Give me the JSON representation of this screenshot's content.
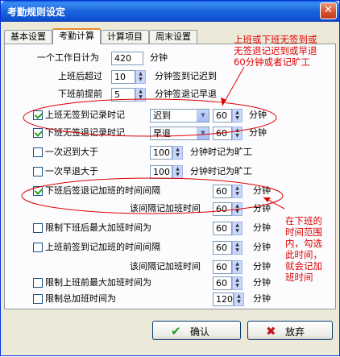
{
  "window": {
    "title": "考勤规则设定",
    "close_glyph": "✕"
  },
  "tabs": [
    "基本设置",
    "考勤计算",
    "计算项目",
    "周末设置"
  ],
  "form": {
    "workday_label": "一个工作日计为",
    "workday_value": "420",
    "workday_unit": "分钟",
    "late_label": "上班后超过",
    "late_value": "10",
    "late_unit": "分钟签到记迟到",
    "early_label": "下班前提前",
    "early_value": "5",
    "early_unit": "分钟签退记早退",
    "no_signin_label": "上班无签到记录时记",
    "no_signin_type": "迟到",
    "no_signin_value": "60",
    "no_signin_unit": "分钟",
    "no_signout_label": "下班无签退记录时记",
    "no_signout_type": "早退",
    "no_signout_value": "60",
    "no_signout_unit": "分钟",
    "late_over_label": "一次迟到大于",
    "late_over_value": "100",
    "late_over_unit": "分钟时记为旷工",
    "early_over_label": "一次早退大于",
    "early_over_value": "100",
    "early_over_unit": "分钟时记为旷工",
    "ot_after_label": "下班后签退记加班的时间间隔",
    "ot_after_value": "60",
    "ot_after_unit": "分钟",
    "ot_after_interval_label": "该间隔记加班时间",
    "ot_after_interval_value": "60",
    "ot_after_interval_unit": "分钟",
    "max_after_label": "限制下班后最大加班时间为",
    "max_after_value": "60",
    "max_after_unit": "分钟",
    "ot_before_label": "上班前签到记加班的时间间隔",
    "ot_before_value": "60",
    "ot_before_unit": "分钟",
    "ot_before_interval_label": "该间隔记加班时间",
    "ot_before_interval_value": "60",
    "ot_before_interval_unit": "分钟",
    "max_before_label": "限制上班前最大加班时间为",
    "max_before_value": "60",
    "max_before_unit": "分钟",
    "max_total_label": "限制总加班时间为",
    "max_total_value": "120",
    "max_total_unit": "分钟"
  },
  "buttons": {
    "ok": "确认",
    "ok_icon": "✔",
    "cancel": "放弃",
    "cancel_icon": "✖"
  },
  "annotations": {
    "top_1": "上班或下班无签到或",
    "top_2": "无签退记迟到或早退",
    "top_3": "60分钟或者记旷工",
    "right_1": "在下班的",
    "right_2": "时间范围",
    "right_3": "内，勾选",
    "right_4": "此时间，",
    "right_5": "就会记加",
    "right_6": "班时间"
  },
  "colors": {
    "annotation_red": "#e00000",
    "title_blue": "#0a5fd8",
    "tab_highlight": "#e68b2c"
  }
}
